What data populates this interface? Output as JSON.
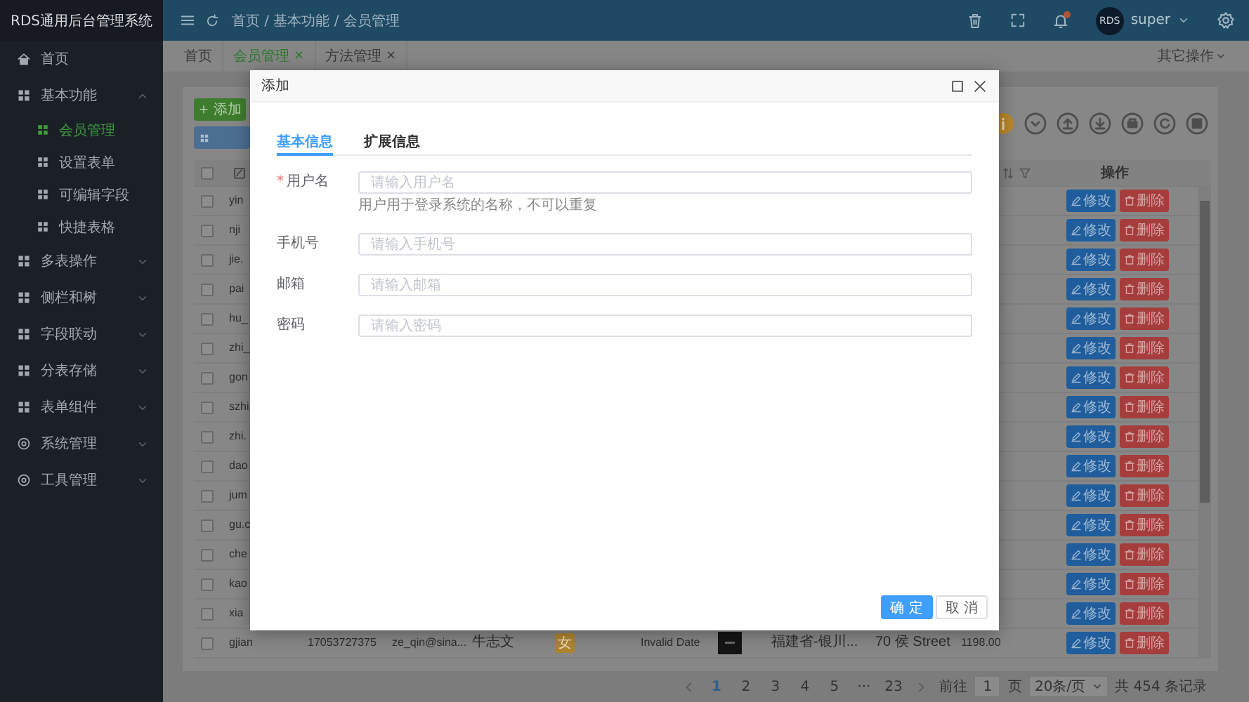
{
  "sidebar": {
    "title": "RDS通用后台管理系统",
    "items": [
      {
        "label": "首页",
        "kind": "link"
      },
      {
        "label": "基本功能",
        "kind": "group",
        "expanded": true,
        "children": [
          {
            "label": "会员管理",
            "selected": true
          },
          {
            "label": "设置表单",
            "selected": false
          },
          {
            "label": "可编辑字段",
            "selected": false
          },
          {
            "label": "快捷表格",
            "selected": false
          }
        ]
      },
      {
        "label": "多表操作",
        "kind": "group",
        "expanded": false
      },
      {
        "label": "侧栏和树",
        "kind": "group",
        "expanded": false
      },
      {
        "label": "字段联动",
        "kind": "group",
        "expanded": false
      },
      {
        "label": "分表存储",
        "kind": "group",
        "expanded": false
      },
      {
        "label": "表单组件",
        "kind": "group",
        "expanded": false
      },
      {
        "label": "系统管理",
        "kind": "group",
        "expanded": false
      },
      {
        "label": "工具管理",
        "kind": "group",
        "expanded": false
      }
    ]
  },
  "header": {
    "breadcrumb": "首页 / 基本功能 / 会员管理",
    "avatar": "RDS",
    "user": "super"
  },
  "tabs": [
    {
      "label": "首页",
      "selected": false
    },
    {
      "label": "会员管理",
      "selected": true,
      "close": "×"
    },
    {
      "label": "方法管理",
      "selected": false,
      "close": "×"
    }
  ],
  "other_actions": "其它操作",
  "toolbar": {
    "add_button": "添加"
  },
  "table": {
    "select_all": {
      "checked": false
    },
    "actions_header": "操作",
    "rows": [
      {
        "checked": false,
        "username": "yin",
        "edit": "修改",
        "delete": "删除"
      },
      {
        "checked": false,
        "username": "nji",
        "edit": "修改",
        "delete": "删除"
      },
      {
        "checked": false,
        "username": "jie.",
        "edit": "修改",
        "delete": "删除"
      },
      {
        "checked": false,
        "username": "pai",
        "edit": "修改",
        "delete": "删除"
      },
      {
        "checked": false,
        "username": "hu_",
        "edit": "修改",
        "delete": "删除"
      },
      {
        "checked": false,
        "username": "zhi_",
        "edit": "修改",
        "delete": "删除"
      },
      {
        "checked": false,
        "username": "gon",
        "edit": "修改",
        "delete": "删除"
      },
      {
        "checked": false,
        "username": "szhi",
        "edit": "修改",
        "delete": "删除"
      },
      {
        "checked": false,
        "username": "zhi.",
        "edit": "修改",
        "delete": "删除"
      },
      {
        "checked": false,
        "username": "dao",
        "edit": "修改",
        "delete": "删除"
      },
      {
        "checked": false,
        "username": "jum",
        "edit": "修改",
        "delete": "删除"
      },
      {
        "checked": false,
        "username": "gu.c",
        "edit": "修改",
        "delete": "删除"
      },
      {
        "checked": false,
        "username": "che",
        "edit": "修改",
        "delete": "删除"
      },
      {
        "checked": false,
        "username": "kao",
        "edit": "修改",
        "delete": "删除"
      },
      {
        "checked": false,
        "username": "xia",
        "edit": "修改",
        "delete": "删除"
      },
      {
        "checked": false,
        "username": "gjian",
        "phone": "17053727375",
        "email": "ze_qin@sina...",
        "name": "牛志文",
        "gender": "女",
        "date": "Invalid Date",
        "address": "福建省-银川...",
        "street": "70 侯 Street",
        "amount": "1198.00",
        "edit": "修改",
        "delete": "删除"
      }
    ]
  },
  "pagination": {
    "pages": [
      {
        "label": "1",
        "selected": true
      },
      {
        "label": "2",
        "selected": false
      },
      {
        "label": "3",
        "selected": false
      },
      {
        "label": "4",
        "selected": false
      },
      {
        "label": "5",
        "selected": false
      },
      {
        "label": "···",
        "selected": false
      },
      {
        "label": "23",
        "selected": false
      }
    ],
    "goto_label": "前往",
    "goto_value": "1",
    "page_unit": "页",
    "page_size": "20条/页",
    "total": "共 454 条记录"
  },
  "modal": {
    "title": "添加",
    "tabs": [
      {
        "label": "基本信息",
        "selected": true
      },
      {
        "label": "扩展信息",
        "selected": false
      }
    ],
    "fields": [
      {
        "label": "用户名",
        "required_mark": "*",
        "placeholder": "请输入用户名",
        "help": "用户用于登录系统的名称，不可以重复"
      },
      {
        "label": "手机号",
        "placeholder": "请输入手机号"
      },
      {
        "label": "邮箱",
        "placeholder": "请输入邮箱"
      },
      {
        "label": "密码",
        "placeholder": "请输入密码"
      }
    ],
    "buttons": [
      {
        "label": "确 定",
        "kind": "primary"
      },
      {
        "label": "取 消",
        "kind": "default"
      }
    ]
  }
}
